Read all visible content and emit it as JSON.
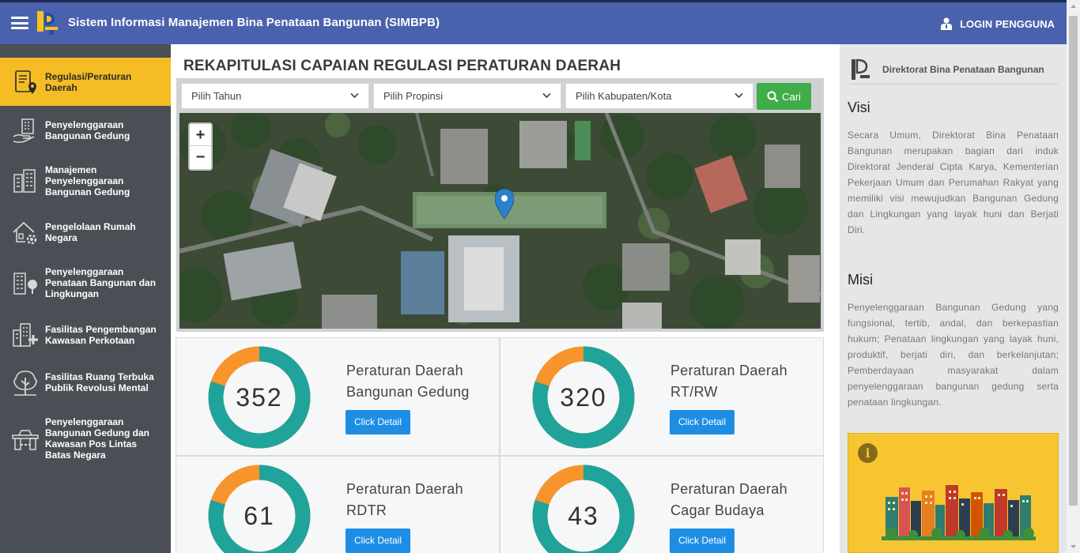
{
  "header": {
    "app_title": "Sistem Informasi Manajemen Bina Penataan Bangunan (SIMBPB)",
    "login_label": "LOGIN PENGGUNA"
  },
  "sidebar": {
    "items": [
      {
        "label": "Regulasi/Peraturan Daerah",
        "icon": "document-map-icon",
        "active": true
      },
      {
        "label": "Penyelenggaraan Bangunan Gedung",
        "icon": "building-hand-icon"
      },
      {
        "label": "Manajemen Penyelenggaraan Bangunan Gedung",
        "icon": "buildings-icon"
      },
      {
        "label": "Pengelolaan Rumah Negara",
        "icon": "house-gear-icon"
      },
      {
        "label": "Penyelenggaraan Penataan Bangunan dan Lingkungan",
        "icon": "building-tree-icon"
      },
      {
        "label": "Fasilitas Pengembangan Kawasan Perkotaan",
        "icon": "city-plus-icon"
      },
      {
        "label": "Fasilitas Ruang Terbuka Publik Revolusi Mental",
        "icon": "tree-park-icon"
      },
      {
        "label": "Penyelenggaraan Bangunan Gedung dan Kawasan Pos Lintas Batas Negara",
        "icon": "border-post-icon"
      }
    ]
  },
  "main": {
    "title": "REKAPITULASI CAPAIAN REGULASI PERATURAN DAERAH",
    "filters": {
      "year_placeholder": "Pilih Tahun",
      "province_placeholder": "Pilih Propinsi",
      "city_placeholder": "Pilih Kabupaten/Kota",
      "search_label": "Cari"
    },
    "map": {
      "zoom_in": "+",
      "zoom_out": "−"
    },
    "cards": [
      {
        "value": "352",
        "title_line1": "Peraturan Daerah",
        "title_line2": "Bangunan Gedung",
        "button": "Click Detail",
        "fraction": 0.8
      },
      {
        "value": "320",
        "title_line1": "Peraturan Daerah",
        "title_line2": "RT/RW",
        "button": "Click Detail",
        "fraction": 0.8
      },
      {
        "value": "61",
        "title_line1": "Peraturan Daerah",
        "title_line2": "RDTR",
        "button": "Click Detail",
        "fraction": 0.8
      },
      {
        "value": "43",
        "title_line1": "Peraturan Daerah",
        "title_line2": "Cagar Budaya",
        "button": "Click Detail",
        "fraction": 0.8
      }
    ]
  },
  "right_panel": {
    "org_name": "Direktorat Bina Penataan Bangunan",
    "visi_heading": "Visi",
    "visi_text": "Secara Umum, Direktorat Bina Penataan Bangunan merupakan bagian dari induk Direktorat Jenderal Cipta Karya, Kementerian Pekerjaan Umum dan Perumahan Rakyat yang memiliki visi mewujudkan Bangunan Gedung dan Lingkungan yang layak huni dan Berjati Diri.",
    "misi_heading": "Misi",
    "misi_text": "Penyelenggaraan Bangunan Gedung yang fungsional, tertib, andal, dan berkepastian hukum; Penataan lingkungan yang layak huni, produktif, berjati diri, dan berkelanjutan; Pemberdayaan masyarakat dalam penyelenggaraan bangunan gedung serta penataan lingkungan."
  },
  "colors": {
    "header": "#4a62ad",
    "sidebar": "#4a4e55",
    "active": "#f5bd23",
    "donut_teal": "#1fa39a",
    "donut_orange": "#f7942b",
    "button_blue": "#1e8ee5",
    "search_green": "#3fae49"
  }
}
